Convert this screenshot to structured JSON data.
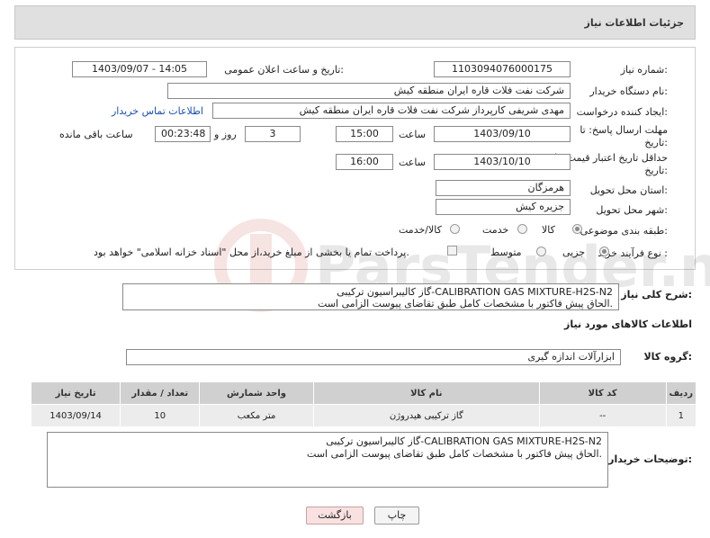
{
  "header": {
    "title": "جزئیات اطلاعات نیاز"
  },
  "form": {
    "need_number_label": "شماره نیاز:",
    "need_number": "1103094076000175",
    "announce_label": "تاریخ و ساعت اعلان عمومی:",
    "announce_value": "1403/09/07 - 14:05",
    "buyer_label": "نام دستگاه خریدار:",
    "buyer_value": "شرکت نفت فلات قاره ایران منطقه کیش",
    "creator_label": "ایجاد کننده درخواست:",
    "creator_value": "مهدی شریفی کارپرداز شرکت نفت فلات قاره ایران منطقه کیش",
    "contact_link": "اطلاعات تماس خریدار",
    "deadline_label_1": "مهلت ارسال پاسخ: تا",
    "deadline_label_2": "تاریخ:",
    "deadline_date": "1403/09/10",
    "hour_label": "ساعت",
    "deadline_time": "15:00",
    "days_value": "3",
    "days_label": "روز و",
    "remaining_time": "00:23:48",
    "remaining_label": "ساعت باقی مانده",
    "validity_label_1": "حداقل تاریخ اعتبار قیمت: تا",
    "validity_label_2": "تاریخ:",
    "validity_date": "1403/10/10",
    "validity_time": "16:00",
    "province_label": "استان محل تحویل:",
    "province_value": "هرمزگان",
    "city_label": "شهر محل تحویل:",
    "city_value": "جزیره کیش",
    "category_label": "طبقه بندی موضوعی:",
    "category_options": [
      "کالا",
      "خدمت",
      "کالا/خدمت"
    ],
    "process_label": "نوع فرآیند خرید :",
    "process_options": [
      "جزیی",
      "متوسط"
    ],
    "payment_note": "پرداخت تمام یا بخشی از مبلغ خرید،از محل \"اسناد خزانه اسلامی\" خواهد بود."
  },
  "description": {
    "label": "شرح کلی نیاز:",
    "line1": "گاز کالیبراسیون ترکیبی-CALIBRATION GAS MIXTURE-H2S-N2",
    "line2": "الحاق پیش فاکتور با مشخصات کامل طبق تقاضای پیوست الزامی است."
  },
  "goods_info_title": "اطلاعات کالاهای مورد نیاز",
  "goods_group": {
    "label": "گروه کالا:",
    "value": "ابزارآلات اندازه گیری"
  },
  "table": {
    "headers": [
      "ردیف",
      "کد کالا",
      "نام کالا",
      "واحد شمارش",
      "تعداد / مقدار",
      "تاریخ نیاز"
    ],
    "rows": [
      [
        "1",
        "--",
        "گاز ترکیبی هیدروژن",
        "متر مکعب",
        "10",
        "1403/09/14"
      ]
    ]
  },
  "buyer_notes": {
    "label": "توضیحات خریدار:",
    "line1": "گاز کالیبراسیون ترکیبی-CALIBRATION GAS MIXTURE-H2S-N2",
    "line2": "الحاق پیش فاکتور با مشخصات کامل طبق تقاضای پیوست الزامی است."
  },
  "buttons": {
    "print": "چاپ",
    "back": "بازگشت"
  },
  "watermark": "ParsTender.net"
}
